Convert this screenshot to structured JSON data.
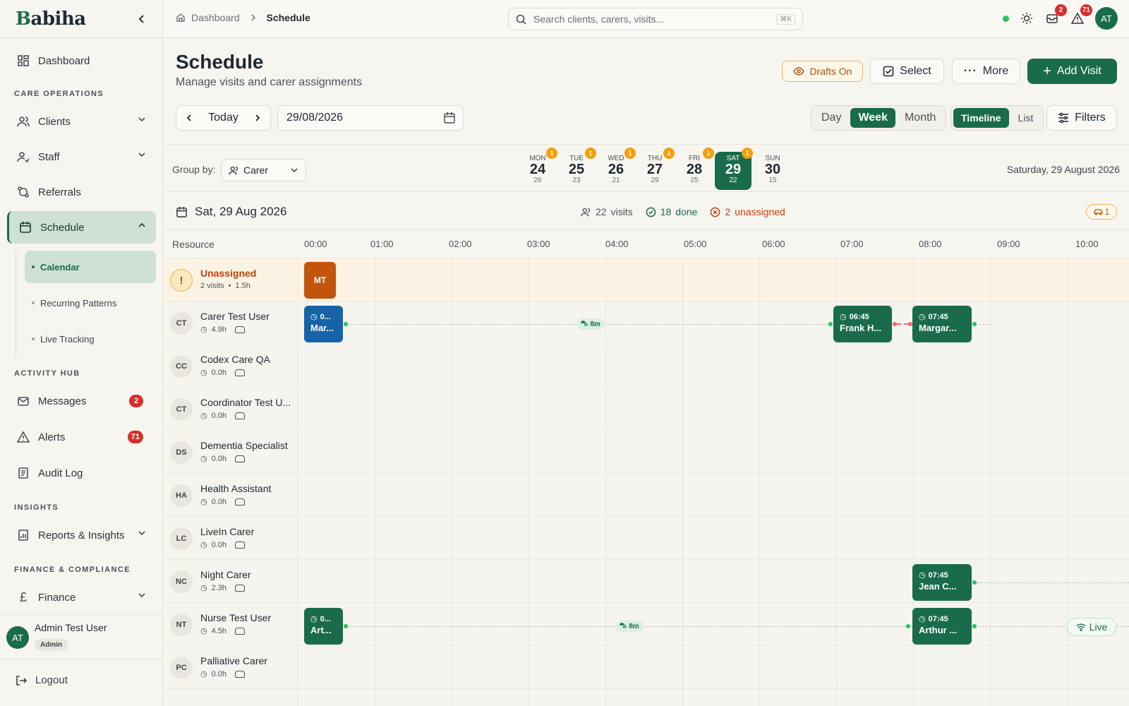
{
  "app": {
    "logo_first": "B",
    "logo_rest": "abiha"
  },
  "sidebar": {
    "dashboard": "Dashboard",
    "section_care": "CARE OPERATIONS",
    "clients": "Clients",
    "staff": "Staff",
    "referrals": "Referrals",
    "schedule": "Schedule",
    "sub_items": [
      "Calendar",
      "Recurring Patterns",
      "Live Tracking"
    ],
    "section_activity": "ACTIVITY HUB",
    "messages": "Messages",
    "messages_count": "2",
    "alerts": "Alerts",
    "alerts_count": "71",
    "audit_log": "Audit Log",
    "section_insights": "INSIGHTS",
    "reports": "Reports & Insights",
    "section_finance": "FINANCE & COMPLIANCE",
    "finance": "Finance",
    "user_initials": "AT",
    "user_name": "Admin Test User",
    "user_role": "Admin",
    "logout": "Logout"
  },
  "topbar": {
    "crumb_root": "Dashboard",
    "crumb_current": "Schedule",
    "search_placeholder": "Search clients, carers, visits...",
    "search_kbd": "⌘K",
    "messages_badge": "2",
    "alerts_badge": "71",
    "avatar": "AT"
  },
  "header": {
    "title": "Schedule",
    "subtitle": "Manage visits and carer assignments",
    "drafts": "Drafts On",
    "select": "Select",
    "more": "More",
    "add_visit": "Add Visit"
  },
  "controls": {
    "today": "Today",
    "date": "29/08/2026",
    "ranges": [
      "Day",
      "Week",
      "Month"
    ],
    "range_selected": "Week",
    "views": [
      "Timeline",
      "List"
    ],
    "view_selected": "Timeline",
    "filters": "Filters"
  },
  "week": {
    "group_by_label": "Group by:",
    "group_by_value": "Carer",
    "days": [
      {
        "name": "MON",
        "date": "24",
        "count": "26",
        "badge": "1"
      },
      {
        "name": "TUE",
        "date": "25",
        "count": "23",
        "badge": "1"
      },
      {
        "name": "WED",
        "date": "26",
        "count": "21",
        "badge": "1"
      },
      {
        "name": "THU",
        "date": "27",
        "count": "29",
        "badge": "1"
      },
      {
        "name": "FRI",
        "date": "28",
        "count": "25",
        "badge": "1"
      },
      {
        "name": "SAT",
        "date": "29",
        "count": "22",
        "badge": "1"
      },
      {
        "name": "SUN",
        "date": "30",
        "count": "15",
        "badge": ""
      }
    ],
    "selected_index": 5,
    "full_date": "Saturday, 29 August 2026"
  },
  "day_summary": {
    "title": "Sat, 29 Aug 2026",
    "visits_count": "22",
    "visits_label": "visits",
    "done_count": "18",
    "done_label": "done",
    "unassigned_count": "2",
    "unassigned_label": "unassigned",
    "travel_count": "1"
  },
  "timeline": {
    "resource_header": "Resource",
    "hours": [
      "00:00",
      "01:00",
      "02:00",
      "03:00",
      "04:00",
      "05:00",
      "06:00",
      "07:00",
      "08:00",
      "09:00",
      "10:00"
    ],
    "rows": [
      {
        "initials": "!",
        "name": "Unassigned",
        "meta1": "2 visits",
        "meta2": "1.5h",
        "type": "unassigned"
      },
      {
        "initials": "CT",
        "name": "Carer Test User",
        "hours": "4.9h"
      },
      {
        "initials": "CC",
        "name": "Codex Care QA",
        "hours": "0.0h"
      },
      {
        "initials": "CT",
        "name": "Coordinator Test U...",
        "hours": "0.0h"
      },
      {
        "initials": "DS",
        "name": "Dementia Specialist",
        "hours": "0.0h"
      },
      {
        "initials": "HA",
        "name": "Health Assistant",
        "hours": "0.0h"
      },
      {
        "initials": "LC",
        "name": "LiveIn Carer",
        "hours": "0.0h"
      },
      {
        "initials": "NC",
        "name": "Night Carer",
        "hours": "2.3h"
      },
      {
        "initials": "NT",
        "name": "Nurse Test User",
        "hours": "4.5h"
      },
      {
        "initials": "PC",
        "name": "Palliative Carer",
        "hours": "0.0h"
      }
    ],
    "visits": {
      "unassigned_mt": "MT",
      "ct_1_time": "0...",
      "ct_1_name": "Mar...",
      "ct_travel": "8m",
      "ct_2_time": "06:45",
      "ct_2_name": "Frank H...",
      "ct_3_time": "07:45",
      "ct_3_name": "Margar...",
      "nc_1_time": "07:45",
      "nc_1_name": "Jean C...",
      "nt_1_time": "0...",
      "nt_1_name": "Art...",
      "nt_travel": "8m",
      "nt_2_time": "07:45",
      "nt_2_name": "Arthur ...",
      "live": "Live"
    }
  },
  "colors": {
    "brand": "#1a6b4c",
    "unassigned": "#c2540c",
    "visit_blue": "#1663a8",
    "badge_red": "#d92d2d",
    "badge_orange": "#f59e0b"
  }
}
